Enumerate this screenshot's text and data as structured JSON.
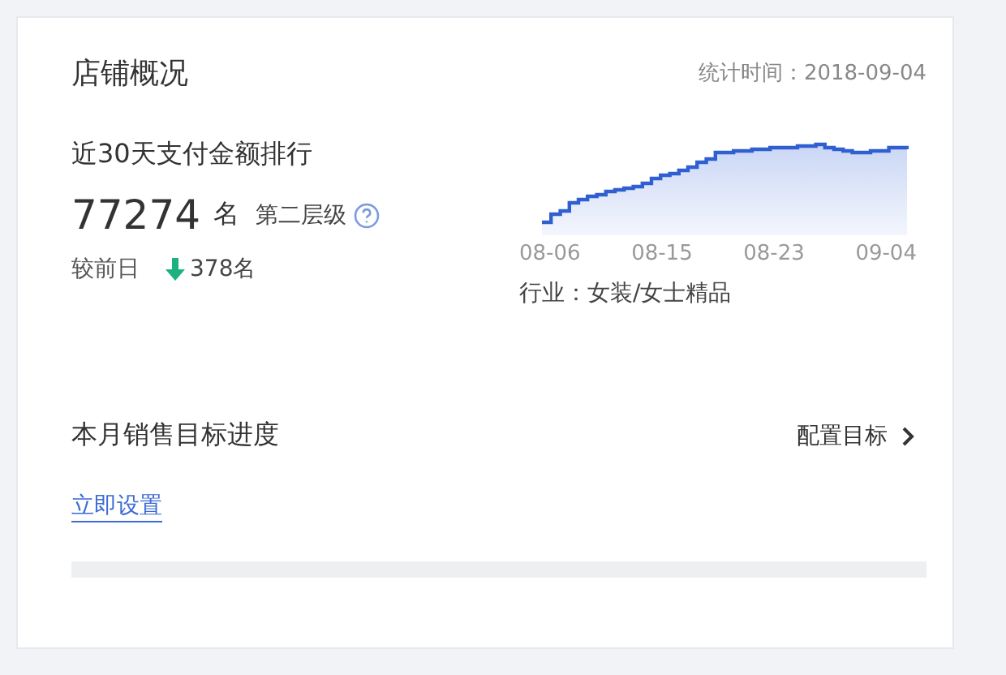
{
  "card": {
    "title": "店铺概况",
    "stat_time": "统计时间：2018-09-04"
  },
  "ranking": {
    "label": "近30天支付金额排行",
    "rank": "77274",
    "unit": "名",
    "tier": "第二层级",
    "compare_label": "较前日",
    "change": {
      "kind": "decrease",
      "text": "378名"
    }
  },
  "trend": {
    "x_labels": [
      "08-06",
      "08-15",
      "08-23",
      "09-04"
    ],
    "industry": "行业：女装/女士精品"
  },
  "goal": {
    "title": "本月销售目标进度",
    "configure": "配置目标",
    "set_now": "立即设置",
    "level": 0
  }
}
